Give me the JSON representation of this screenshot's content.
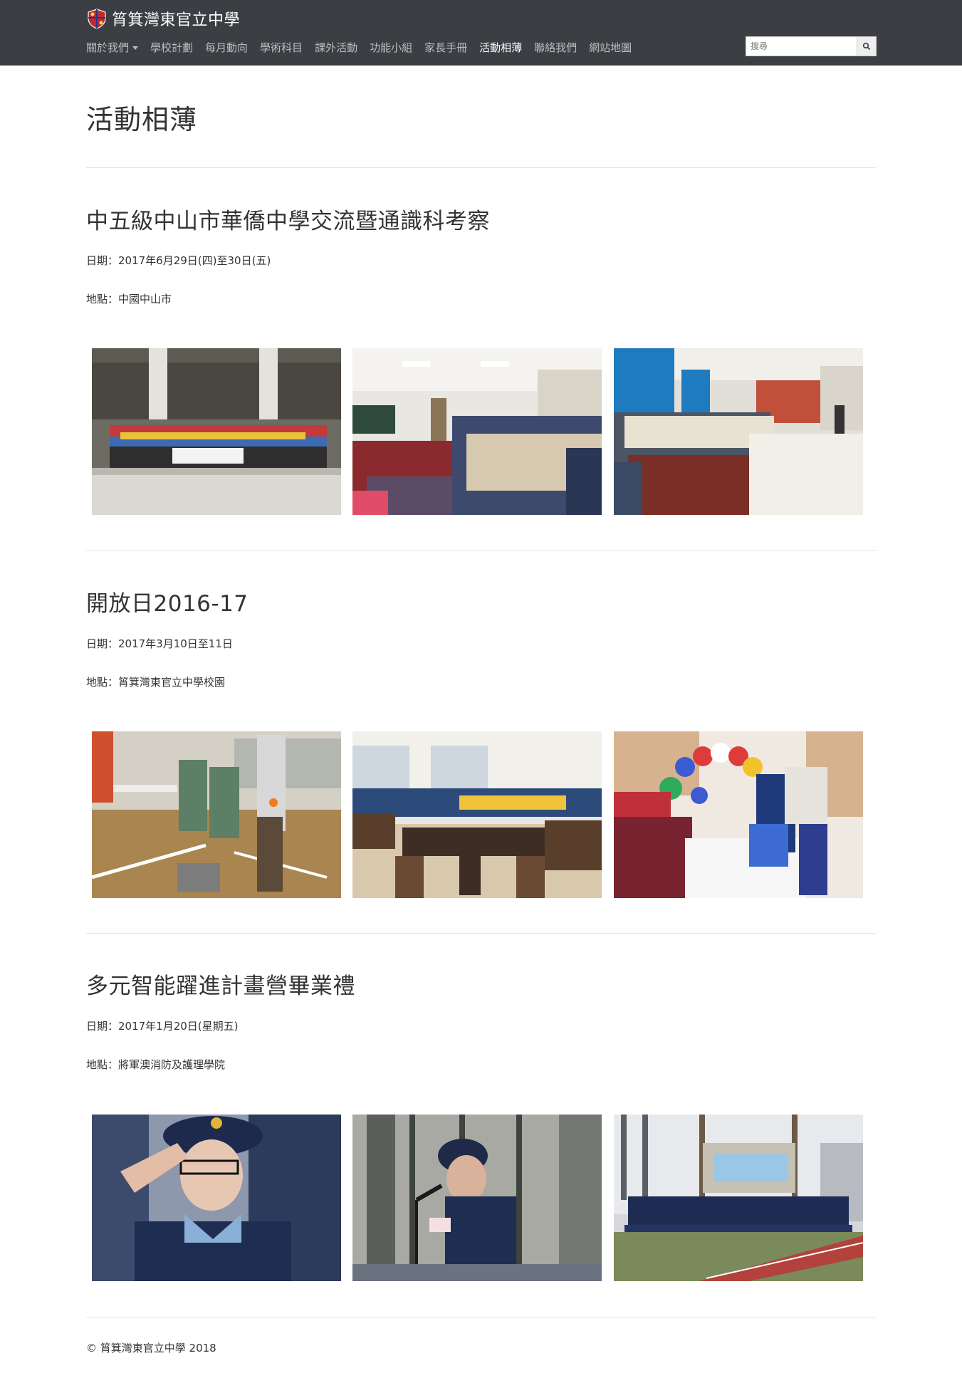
{
  "header": {
    "site_name": "筲箕灣東官立中學",
    "nav": [
      {
        "label": "關於我們",
        "dropdown": true,
        "active": false
      },
      {
        "label": "學校計劃",
        "active": false
      },
      {
        "label": "每月動向",
        "active": false
      },
      {
        "label": "學術科目",
        "active": false
      },
      {
        "label": "課外活動",
        "active": false
      },
      {
        "label": "功能小組",
        "active": false
      },
      {
        "label": "家長手冊",
        "active": false
      },
      {
        "label": "活動相薄",
        "active": true
      },
      {
        "label": "聯絡我們",
        "active": false
      },
      {
        "label": "網站地圖",
        "active": false
      }
    ],
    "search_placeholder": "搜尋"
  },
  "page": {
    "title": "活動相薄"
  },
  "albums": [
    {
      "title": "中五級中山市華僑中學交流暨通識科考察",
      "date": "日期：2017年6月29日(四)至30日(五)",
      "location": "地點：中國中山市",
      "photos": [
        "group-photo-campus",
        "classroom-exchange",
        "lecture-hall-talk"
      ]
    },
    {
      "title": "開放日2016-17",
      "date": "日期：2017年3月10日至11日",
      "location": "地點：筲箕灣東官立中學校園",
      "photos": [
        "robotics-demo",
        "lab-visitors",
        "balloon-activity-booth"
      ]
    },
    {
      "title": "多元智能躍進計畫營畢業禮",
      "date": "日期：2017年1月20日(星期五)",
      "location": "地點：將軍澳消防及護理學院",
      "photos": [
        "cadet-salute",
        "cadet-speech",
        "graduation-group-photo"
      ]
    }
  ],
  "footer": {
    "copyright": "© 筲箕灣東官立中學 2018"
  },
  "colors": {
    "navbar_bg": "#3b3e42",
    "nav_text": "#bdbdbd",
    "nav_active": "#ffffff",
    "divider": "#e3e3e3"
  }
}
